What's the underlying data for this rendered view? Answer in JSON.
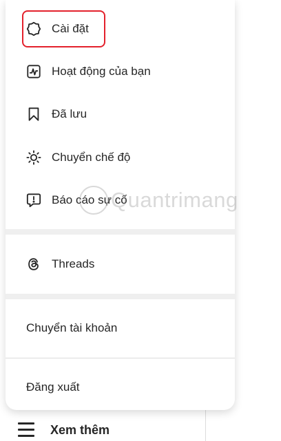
{
  "menu": {
    "items": [
      {
        "label": "Cài đặt",
        "icon": "gear-icon"
      },
      {
        "label": "Hoạt động của bạn",
        "icon": "activity-icon"
      },
      {
        "label": "Đã lưu",
        "icon": "bookmark-icon"
      },
      {
        "label": "Chuyển chế độ",
        "icon": "sun-icon"
      },
      {
        "label": "Báo cáo sự cố",
        "icon": "report-icon"
      }
    ],
    "threads": {
      "label": "Threads",
      "icon": "threads-icon"
    },
    "account": {
      "switch_label": "Chuyển tài khoản",
      "logout_label": "Đăng xuất"
    }
  },
  "watermark": {
    "text": "Quantrimang"
  },
  "more": {
    "label": "Xem thêm",
    "icon": "menu-icon"
  },
  "colors": {
    "highlight": "#e3202b",
    "text": "#262626",
    "separator": "#efefef"
  }
}
